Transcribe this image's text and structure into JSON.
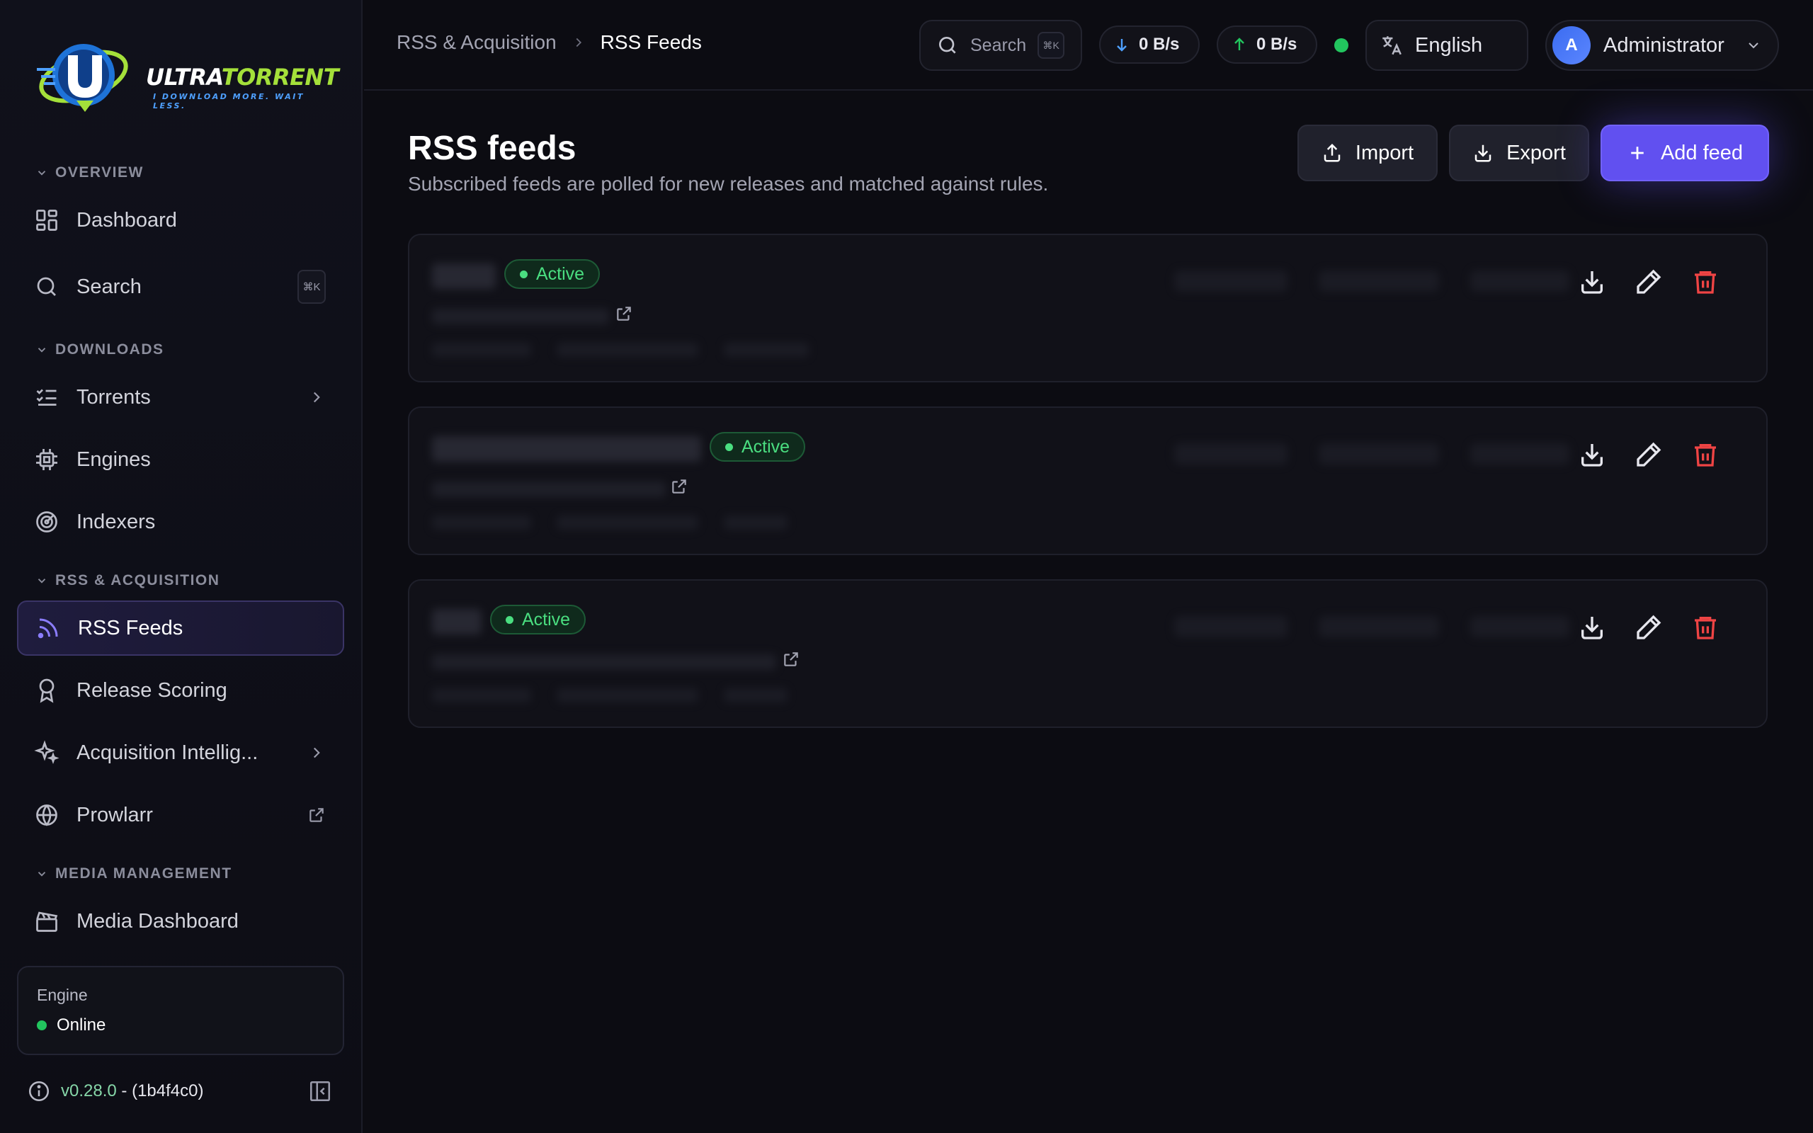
{
  "brand": {
    "name_a": "ULTRA",
    "name_b": "TORRENT",
    "tagline": "I DOWNLOAD MORE. WAIT LESS."
  },
  "sidebar": {
    "sections": [
      {
        "label": "OVERVIEW"
      },
      {
        "label": "DOWNLOADS"
      },
      {
        "label": "RSS & ACQUISITION"
      },
      {
        "label": "MEDIA MANAGEMENT"
      }
    ],
    "items": [
      {
        "label": "Dashboard",
        "icon": "dashboard-icon"
      },
      {
        "label": "Search",
        "icon": "search-icon",
        "shortcut": "⌘K"
      },
      {
        "label": "Torrents",
        "icon": "list-icon"
      },
      {
        "label": "Engines",
        "icon": "chip-icon"
      },
      {
        "label": "Indexers",
        "icon": "radar-icon"
      },
      {
        "label": "RSS Feeds",
        "icon": "rss-icon",
        "active": true
      },
      {
        "label": "Release Scoring",
        "icon": "award-icon"
      },
      {
        "label": "Acquisition Intellig...",
        "icon": "sparkles-icon"
      },
      {
        "label": "Prowlarr",
        "icon": "globe-icon"
      },
      {
        "label": "Media Dashboard",
        "icon": "clapperboard-icon"
      }
    ],
    "engine": {
      "label": "Engine",
      "status": "Online"
    },
    "version": {
      "number": "v0.28.0",
      "sep": "-",
      "hash": "(1b4f4c0)"
    }
  },
  "header": {
    "breadcrumb": [
      "RSS & Acquisition",
      "RSS Feeds"
    ],
    "search_label": "Search",
    "search_shortcut": "⌘K",
    "download_speed": "0 B/s",
    "upload_speed": "0 B/s",
    "language": "English",
    "user": {
      "initial": "A",
      "name": "Administrator"
    }
  },
  "page": {
    "title": "RSS feeds",
    "subtitle": "Subscribed feeds are polled for new releases and matched against rules.",
    "buttons": {
      "import": "Import",
      "export": "Export",
      "add": "Add feed"
    }
  },
  "feeds": [
    {
      "status": "Active"
    },
    {
      "status": "Active"
    },
    {
      "status": "Active"
    }
  ],
  "colors": {
    "accent": "#6150f0",
    "success": "#22c55e",
    "danger": "#ef4444",
    "background": "#0c0c12"
  }
}
